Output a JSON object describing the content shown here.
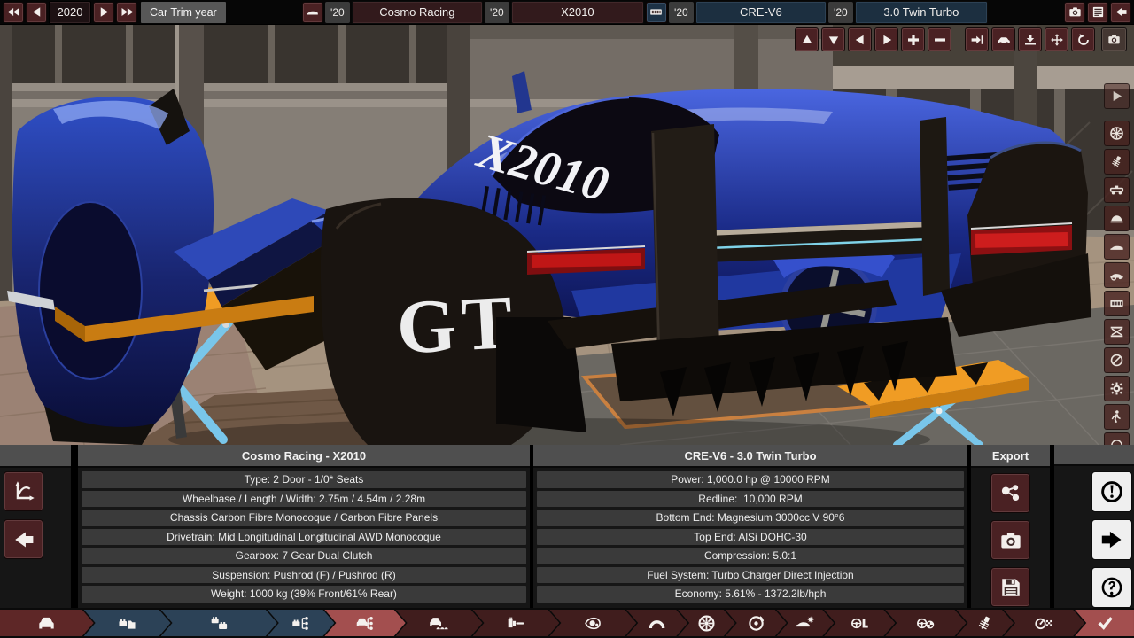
{
  "colors": {
    "accent_active_tab": "#a34f4f",
    "tab_red": "#401d1d",
    "tab_blue": "#2c4257",
    "button_maroon": "#4a2123",
    "engine_blue": "#1d3246",
    "warning_yellow": "#c3a02a",
    "car_paint_blue": "#1b2b82",
    "lift_blue": "#79c6ea",
    "lift_orange": "#ef9b22",
    "tail_light_red": "#c01616"
  },
  "top_bar": {
    "year": "2020",
    "year_mode_label": "Car Trim year",
    "model_year": "'20",
    "model_name": "Cosmo Racing",
    "trim_year": "'20",
    "trim_name": "X2010",
    "engine_year": "'20",
    "engine_family": "CRE-V6",
    "variant_year": "'20",
    "variant_name": "3.0 Twin Turbo"
  },
  "view_toolbar": [
    "pan-up",
    "pan-down",
    "pan-left",
    "pan-right",
    "zoom-in",
    "zoom-out",
    "snap-to-end",
    "reset-car",
    "drop-to-ground",
    "move-tool",
    "rotate-tool"
  ],
  "side_toolbar": [
    "play",
    "wheels",
    "suspension",
    "chassis",
    "body-shell",
    "car-side",
    "car-wheels",
    "engine",
    "lift",
    "no-driver",
    "settings-gear",
    "pedestrian",
    "circle-tool"
  ],
  "scene": {
    "car_side_text": "X2010",
    "car_pod_text": "GT"
  },
  "panels": {
    "car": {
      "title": "Cosmo Racing - X2010",
      "rows": [
        "Type: 2 Door - 1/0* Seats",
        "Wheelbase / Length / Width: 2.75m / 4.54m / 2.28m",
        "Chassis Carbon Fibre Monocoque / Carbon Fibre Panels",
        "Drivetrain: Mid Longitudinal Longitudinal AWD Monocoque",
        "Gearbox: 7 Gear Dual Clutch",
        "Suspension: Pushrod (F) / Pushrod (R)",
        "Weight: 1000 kg (39% Front/61% Rear)"
      ]
    },
    "engine": {
      "title": "CRE-V6 - 3.0 Twin Turbo",
      "rows": [
        "Power: 1,000.0 hp @ 10000 RPM",
        "Redline:  10,000 RPM",
        "Bottom End: Magnesium 3000cc V 90°6",
        "Top End: AlSi DOHC-30",
        "Compression: 5.0:1",
        "Fuel System: Turbo Charger Direct Injection",
        "Economy: 5.61% - 1372.2lb/hph"
      ]
    },
    "export": {
      "title": "Export",
      "buttons": [
        "share",
        "camera",
        "save"
      ]
    },
    "actions": [
      "warning",
      "forward-arrow",
      "help"
    ],
    "side_buttons": [
      "graph",
      "back-arrow"
    ]
  },
  "tabs": [
    {
      "icon": "car-front",
      "group": "first"
    },
    {
      "icon": "engine-folder",
      "group": "blue"
    },
    {
      "icon": "engine-family",
      "group": "blue"
    },
    {
      "icon": "engine-tree",
      "group": "blue"
    },
    {
      "icon": "car-tree",
      "group": "active"
    },
    {
      "icon": "car-bodies",
      "group": "red"
    },
    {
      "icon": "paint-brush",
      "group": "red"
    },
    {
      "icon": "headlight",
      "group": "red"
    },
    {
      "icon": "wheel-arch",
      "group": "red"
    },
    {
      "icon": "wheels",
      "group": "red"
    },
    {
      "icon": "brake-disc",
      "group": "red"
    },
    {
      "icon": "car-cooling",
      "group": "red"
    },
    {
      "icon": "interior",
      "group": "red"
    },
    {
      "icon": "driver-assists",
      "group": "red"
    },
    {
      "icon": "suspension",
      "group": "red"
    },
    {
      "icon": "test-track",
      "group": "red"
    },
    {
      "icon": "check",
      "group": "active"
    }
  ]
}
